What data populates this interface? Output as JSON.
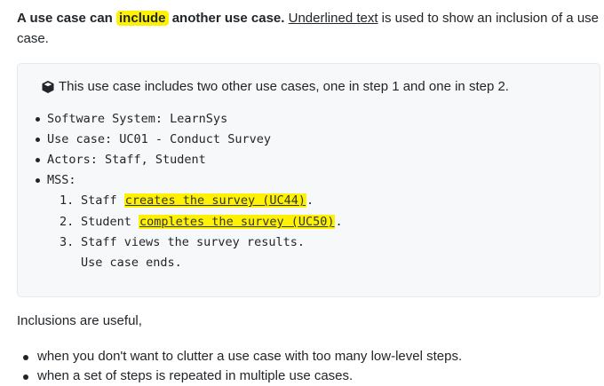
{
  "intro": {
    "part1": "A use case can ",
    "keyword": "include",
    "part2": " another use case.",
    "underlined": "Underlined text",
    "rest": " is used to show an inclusion of a use case."
  },
  "box": {
    "note_icon": "box-icon",
    "note": "This use case includes two other use cases, one in step 1 and one in step 2.",
    "items": [
      "Software System: LearnSys",
      "Use case: UC01 - Conduct Survey",
      "Actors: Staff, Student",
      "MSS:"
    ],
    "steps": [
      {
        "num": "1.",
        "pre": "Staff ",
        "link": "creates the survey (UC44)",
        "post": "."
      },
      {
        "num": "2.",
        "pre": "Student ",
        "link": "completes the survey (UC50)",
        "post": "."
      },
      {
        "num": "3.",
        "pre": "Staff views the survey results.",
        "link": "",
        "post": ""
      }
    ],
    "ending": "Use case ends."
  },
  "para": "Inclusions are useful,",
  "bullets": [
    "when you don't want to clutter a use case with too many low-level steps.",
    "when a set of steps is repeated in multiple use cases."
  ],
  "colors": {
    "highlight": "#fff200",
    "box_bg": "#f6f8fa"
  }
}
